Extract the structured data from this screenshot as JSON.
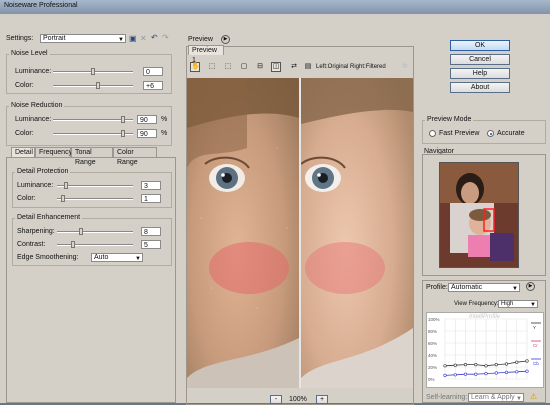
{
  "window": {
    "title": "Noiseware Professional"
  },
  "settings": {
    "label": "Settings:",
    "value": "Portrait"
  },
  "noise_level": {
    "title": "Noise Level",
    "luminance": {
      "label": "Luminance:",
      "value": "0",
      "level": 0.5
    },
    "color": {
      "label": "Color:",
      "value": "+6",
      "level": 0.56
    }
  },
  "noise_reduction": {
    "title": "Noise Reduction",
    "luminance": {
      "label": "Luminance:",
      "value": "90",
      "unit": "%",
      "level": 0.9
    },
    "color": {
      "label": "Color:",
      "value": "90",
      "unit": "%",
      "level": 0.9
    }
  },
  "tabs": [
    "Detail",
    "Frequency",
    "Tonal Range",
    "Color Range"
  ],
  "detail_protection": {
    "title": "Detail Protection",
    "luminance": {
      "label": "Luminance:",
      "value": "3",
      "level": 0.1
    },
    "color": {
      "label": "Color:",
      "value": "1",
      "level": 0.05
    }
  },
  "detail_enhancement": {
    "title": "Detail Enhancement",
    "sharpening": {
      "label": "Sharpening:",
      "value": "8",
      "level": 0.3
    },
    "contrast": {
      "label": "Contrast:",
      "value": "5",
      "level": 0.2
    },
    "edge_smoothening": {
      "label": "Edge Smoothening:",
      "value": "Auto"
    }
  },
  "preview": {
    "title": "Preview",
    "tab": "Preview 1",
    "layout_text": "Left:Original Right:Filtered",
    "zoom": "100%",
    "zoom_out": "-",
    "zoom_in": "+"
  },
  "buttons": {
    "ok": "OK",
    "cancel": "Cancel",
    "help": "Help",
    "about": "About"
  },
  "preview_mode": {
    "title": "Preview Mode",
    "fast": "Fast Preview",
    "accurate": "Accurate",
    "selected": "accurate"
  },
  "navigator": {
    "title": "Navigator"
  },
  "profile": {
    "label": "Profile:",
    "value": "Automatic",
    "view_frequency_label": "View Frequency:",
    "view_frequency_value": "High",
    "watermark": "IntelliProfile",
    "y_ticks": [
      "100%",
      "80%",
      "60%",
      "40%",
      "20%",
      "0%"
    ],
    "legend": [
      "Y",
      "Cr",
      "Cb"
    ],
    "colors": {
      "y": "#333333",
      "cr": "#d04060",
      "cb": "#3b3bd8"
    },
    "series": {
      "y": [
        0.22,
        0.23,
        0.24,
        0.24,
        0.22,
        0.24,
        0.25,
        0.28,
        0.3
      ],
      "cb": [
        0.06,
        0.07,
        0.08,
        0.08,
        0.09,
        0.1,
        0.11,
        0.12,
        0.13
      ]
    },
    "self_learning_label": "Self-learning:",
    "learn_apply": "Learn & Apply"
  },
  "colors": {
    "accent": "#2d5fa3",
    "chrome": "#d4d0c8"
  }
}
